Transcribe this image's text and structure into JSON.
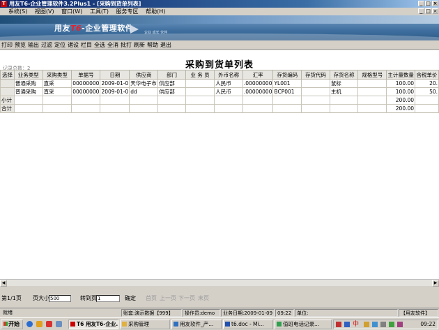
{
  "window": {
    "title": "用友T6-企业管理软件3.2Plus1 - [采购到货单列表]"
  },
  "menubar": [
    "系统(S)",
    "视图(V)",
    "窗口(W)",
    "工具(T)",
    "服务专区",
    "帮助(H)"
  ],
  "banner": {
    "brand_pre": "用友",
    "brand_t6": "T6",
    "brand_post": "-企业管理软件",
    "subtext": "企业 成长 伙伴"
  },
  "toolbar": [
    "打印",
    "预览",
    "输出",
    "过滤",
    "定位",
    "诸设",
    "栏目",
    "全选",
    "全消",
    "批打",
    "刷新",
    "帮助",
    "退出"
  ],
  "report": {
    "title": "采购到货单列表",
    "record_count": "记录总数：2",
    "columns": [
      "选择",
      "业务类型",
      "采购类型",
      "单据号",
      "日期",
      "供应商",
      "部门",
      "业 务 员",
      "外币名称",
      "汇率",
      "存货编码",
      "存货代码",
      "存货名称",
      "规格型号",
      "主计量数量",
      "含税单价"
    ],
    "rows": [
      [
        "",
        "普通采购",
        "直采",
        "00000000",
        "2009-01-0",
        "天华电子市",
        "供应部",
        "",
        "人民币",
        ".00000000",
        "YL001",
        "",
        "鼠标",
        "",
        "100.00",
        "20."
      ],
      [
        "",
        "普通采购",
        "直采",
        "00000000",
        "2009-01-0",
        "dd",
        "供应部",
        "",
        "人民币",
        ".00000000",
        "BCP001",
        "",
        "主机",
        "",
        "100.00",
        "50."
      ],
      [
        "小计",
        "",
        "",
        "",
        "",
        "",
        "",
        "",
        "",
        "",
        "",
        "",
        "",
        "",
        "200.00",
        ""
      ],
      [
        "合计",
        "",
        "",
        "",
        "",
        "",
        "",
        "",
        "",
        "",
        "",
        "",
        "",
        "",
        "200.00",
        ""
      ]
    ]
  },
  "pager": {
    "page_info": "第1/1页",
    "page_size_label": "页大小",
    "page_size_value": "500",
    "goto_label": "转到页",
    "goto_value": "1",
    "confirm": "确定",
    "first": "首页",
    "prev": "上一页",
    "next": "下一页",
    "last": "末页"
  },
  "statusbar": {
    "ready": "就绪",
    "account": "账套:演示数据【999】",
    "operator": "操作员:demo",
    "business_date": "业务日期:2009-01-09",
    "time": "09:22",
    "unit": "单位:",
    "company": "【用友软件】"
  },
  "taskbar": {
    "start": "开始",
    "tasks": [
      "T6 用友T6-企业...",
      "采购管理",
      "用友软件_产...",
      "t6.doc - Mi...",
      "值班电话记录..."
    ],
    "clock": "09:22"
  }
}
